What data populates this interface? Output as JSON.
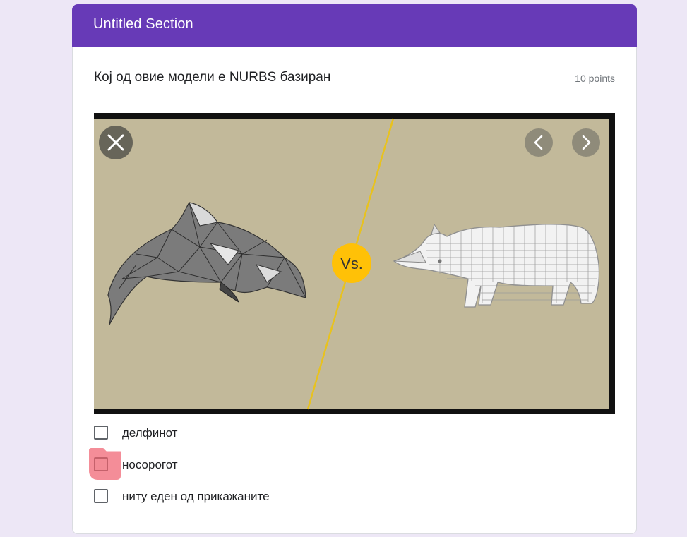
{
  "section": {
    "title": "Untitled Section"
  },
  "question": {
    "title": "Кој од овие модели е NURBS базиран",
    "points": "10 points",
    "image": {
      "vs_label": "Vs.",
      "close_icon": "close-icon",
      "prev_icon": "chevron-left-icon",
      "next_icon": "chevron-right-icon"
    },
    "options": [
      {
        "label": "делфинот",
        "checked": false
      },
      {
        "label": "носорогот",
        "checked": false,
        "highlighted": true
      },
      {
        "label": "ниту еден од прикажаните",
        "checked": false
      }
    ]
  },
  "colors": {
    "accent": "#673ab7",
    "background": "#ede7f6",
    "image_bg": "#c2b99a",
    "vs_badge": "#ffc107",
    "highlight": "#f48d98"
  }
}
